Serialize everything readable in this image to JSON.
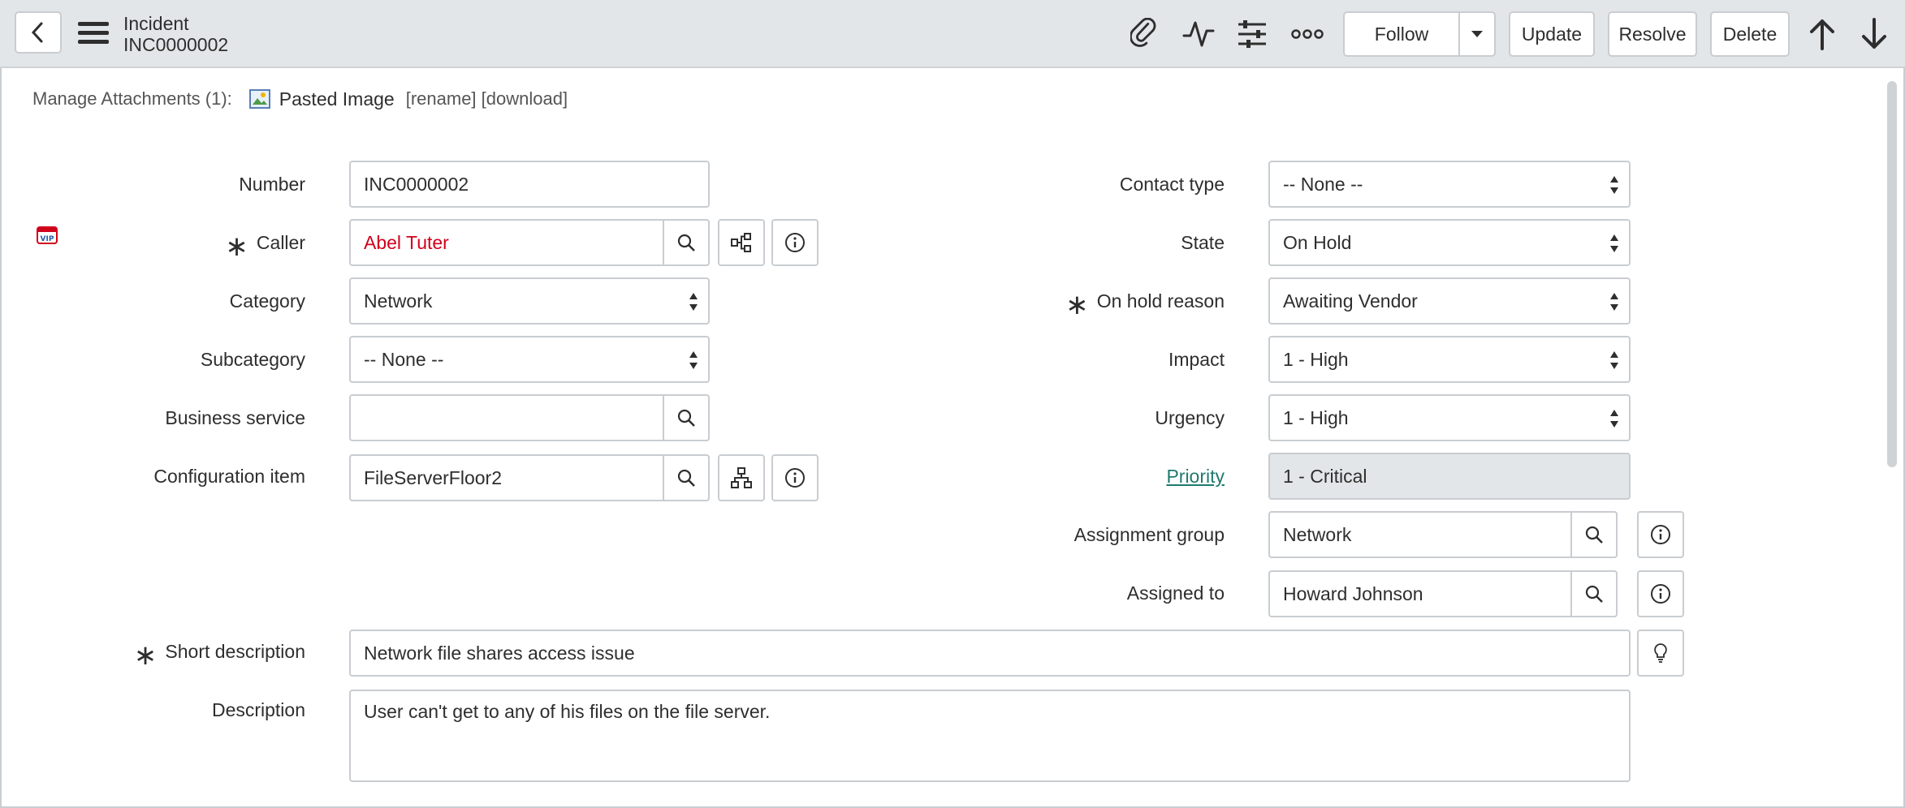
{
  "header": {
    "record_type": "Incident",
    "record_number": "INC0000002",
    "follow_label": "Follow",
    "update_label": "Update",
    "resolve_label": "Resolve",
    "delete_label": "Delete"
  },
  "attachments": {
    "label": "Manage Attachments (1):",
    "file_name": "Pasted Image",
    "links": "[rename] [download]"
  },
  "form": {
    "number": {
      "label": "Number",
      "value": "INC0000002"
    },
    "caller": {
      "label": "Caller",
      "value": "Abel Tuter"
    },
    "category": {
      "label": "Category",
      "value": "Network"
    },
    "subcategory": {
      "label": "Subcategory",
      "value": "-- None --"
    },
    "business_service": {
      "label": "Business service",
      "value": ""
    },
    "configuration_item": {
      "label": "Configuration item",
      "value": "FileServerFloor2"
    },
    "contact_type": {
      "label": "Contact type",
      "value": "-- None --"
    },
    "state": {
      "label": "State",
      "value": "On Hold"
    },
    "on_hold_reason": {
      "label": "On hold reason",
      "value": "Awaiting Vendor"
    },
    "impact": {
      "label": "Impact",
      "value": "1 - High"
    },
    "urgency": {
      "label": "Urgency",
      "value": "1 - High"
    },
    "priority": {
      "label": "Priority",
      "value": "1 - Critical"
    },
    "assignment_group": {
      "label": "Assignment group",
      "value": "Network"
    },
    "assigned_to": {
      "label": "Assigned to",
      "value": "Howard Johnson"
    },
    "short_description": {
      "label": "Short description",
      "value": "Network file shares access issue"
    },
    "description": {
      "label": "Description",
      "value": "User can't get to any of his files on the file server."
    }
  },
  "icons": {
    "back": "chevron-left-icon",
    "menu": "hamburger-icon",
    "attach": "paperclip-icon",
    "activity": "pulse-icon",
    "personalize": "sliders-icon",
    "more": "more-dots-icon",
    "up": "arrow-up-icon",
    "down": "arrow-down-icon",
    "search": "magnifier-icon",
    "info": "info-icon",
    "dependency": "dependency-map-icon",
    "tree": "hierarchy-icon",
    "suggest": "lightbulb-icon",
    "vip": "vip-icon",
    "image": "image-icon"
  },
  "colors": {
    "header_bg": "#e3e6e8",
    "caller_vip": "#d0021b",
    "link": "#1f7a6e"
  }
}
